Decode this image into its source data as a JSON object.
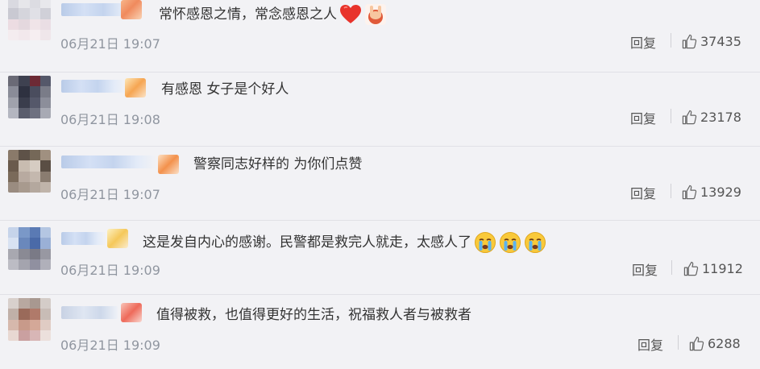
{
  "comments": [
    {
      "text": "常怀感恩之情，常念感恩之人",
      "time": "06月21日 19:07",
      "reply": "回复",
      "likes": "37435",
      "emojis": [
        "heart",
        "peace"
      ]
    },
    {
      "text": "有感恩 女子是个好人",
      "time": "06月21日 19:08",
      "reply": "回复",
      "likes": "23178",
      "emojis": []
    },
    {
      "text": "警察同志好样的 为你们点赞",
      "time": "06月21日 19:07",
      "reply": "回复",
      "likes": "13929",
      "emojis": []
    },
    {
      "text": "这是发自内心的感谢。民警都是救完人就走，太感人了",
      "time": "06月21日 19:09",
      "reply": "回复",
      "likes": "11912",
      "emojis": [
        "crying",
        "crying",
        "crying"
      ]
    },
    {
      "text": "值得被救，也值得更好的生活，祝福救人者与被救者",
      "time": "06月21日 19:09",
      "reply": "回复",
      "likes": "6288",
      "emojis": []
    }
  ],
  "colors": {
    "background": "#f2f2f5",
    "time": "#9096a0",
    "text": "#333333"
  },
  "icons": {
    "like": "thumbs-up-icon",
    "heart": "red-heart-emoji",
    "peace": "peace-hands-emoji",
    "crying": "crying-face-emoji"
  }
}
